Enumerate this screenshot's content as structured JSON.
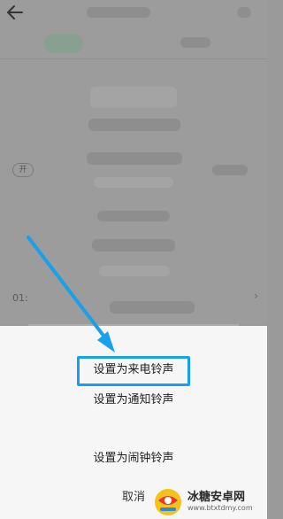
{
  "background": {
    "pill_text": "开",
    "time_text": "01:"
  },
  "sheet": {
    "options": [
      {
        "label": "设置为来电铃声"
      },
      {
        "label": "设置为通知铃声"
      },
      {
        "label": "设置为闹钟铃声"
      }
    ],
    "cancel_label": "取消"
  },
  "annotation": {
    "highlight_color": "#19a0ea",
    "arrow_color": "#19a0ea"
  },
  "watermark": {
    "title": "冰糖安卓网",
    "url": "www.btxtdmy.com"
  },
  "icons": {
    "back": "back-arrow-icon",
    "logo": "btxt-logo-icon"
  }
}
